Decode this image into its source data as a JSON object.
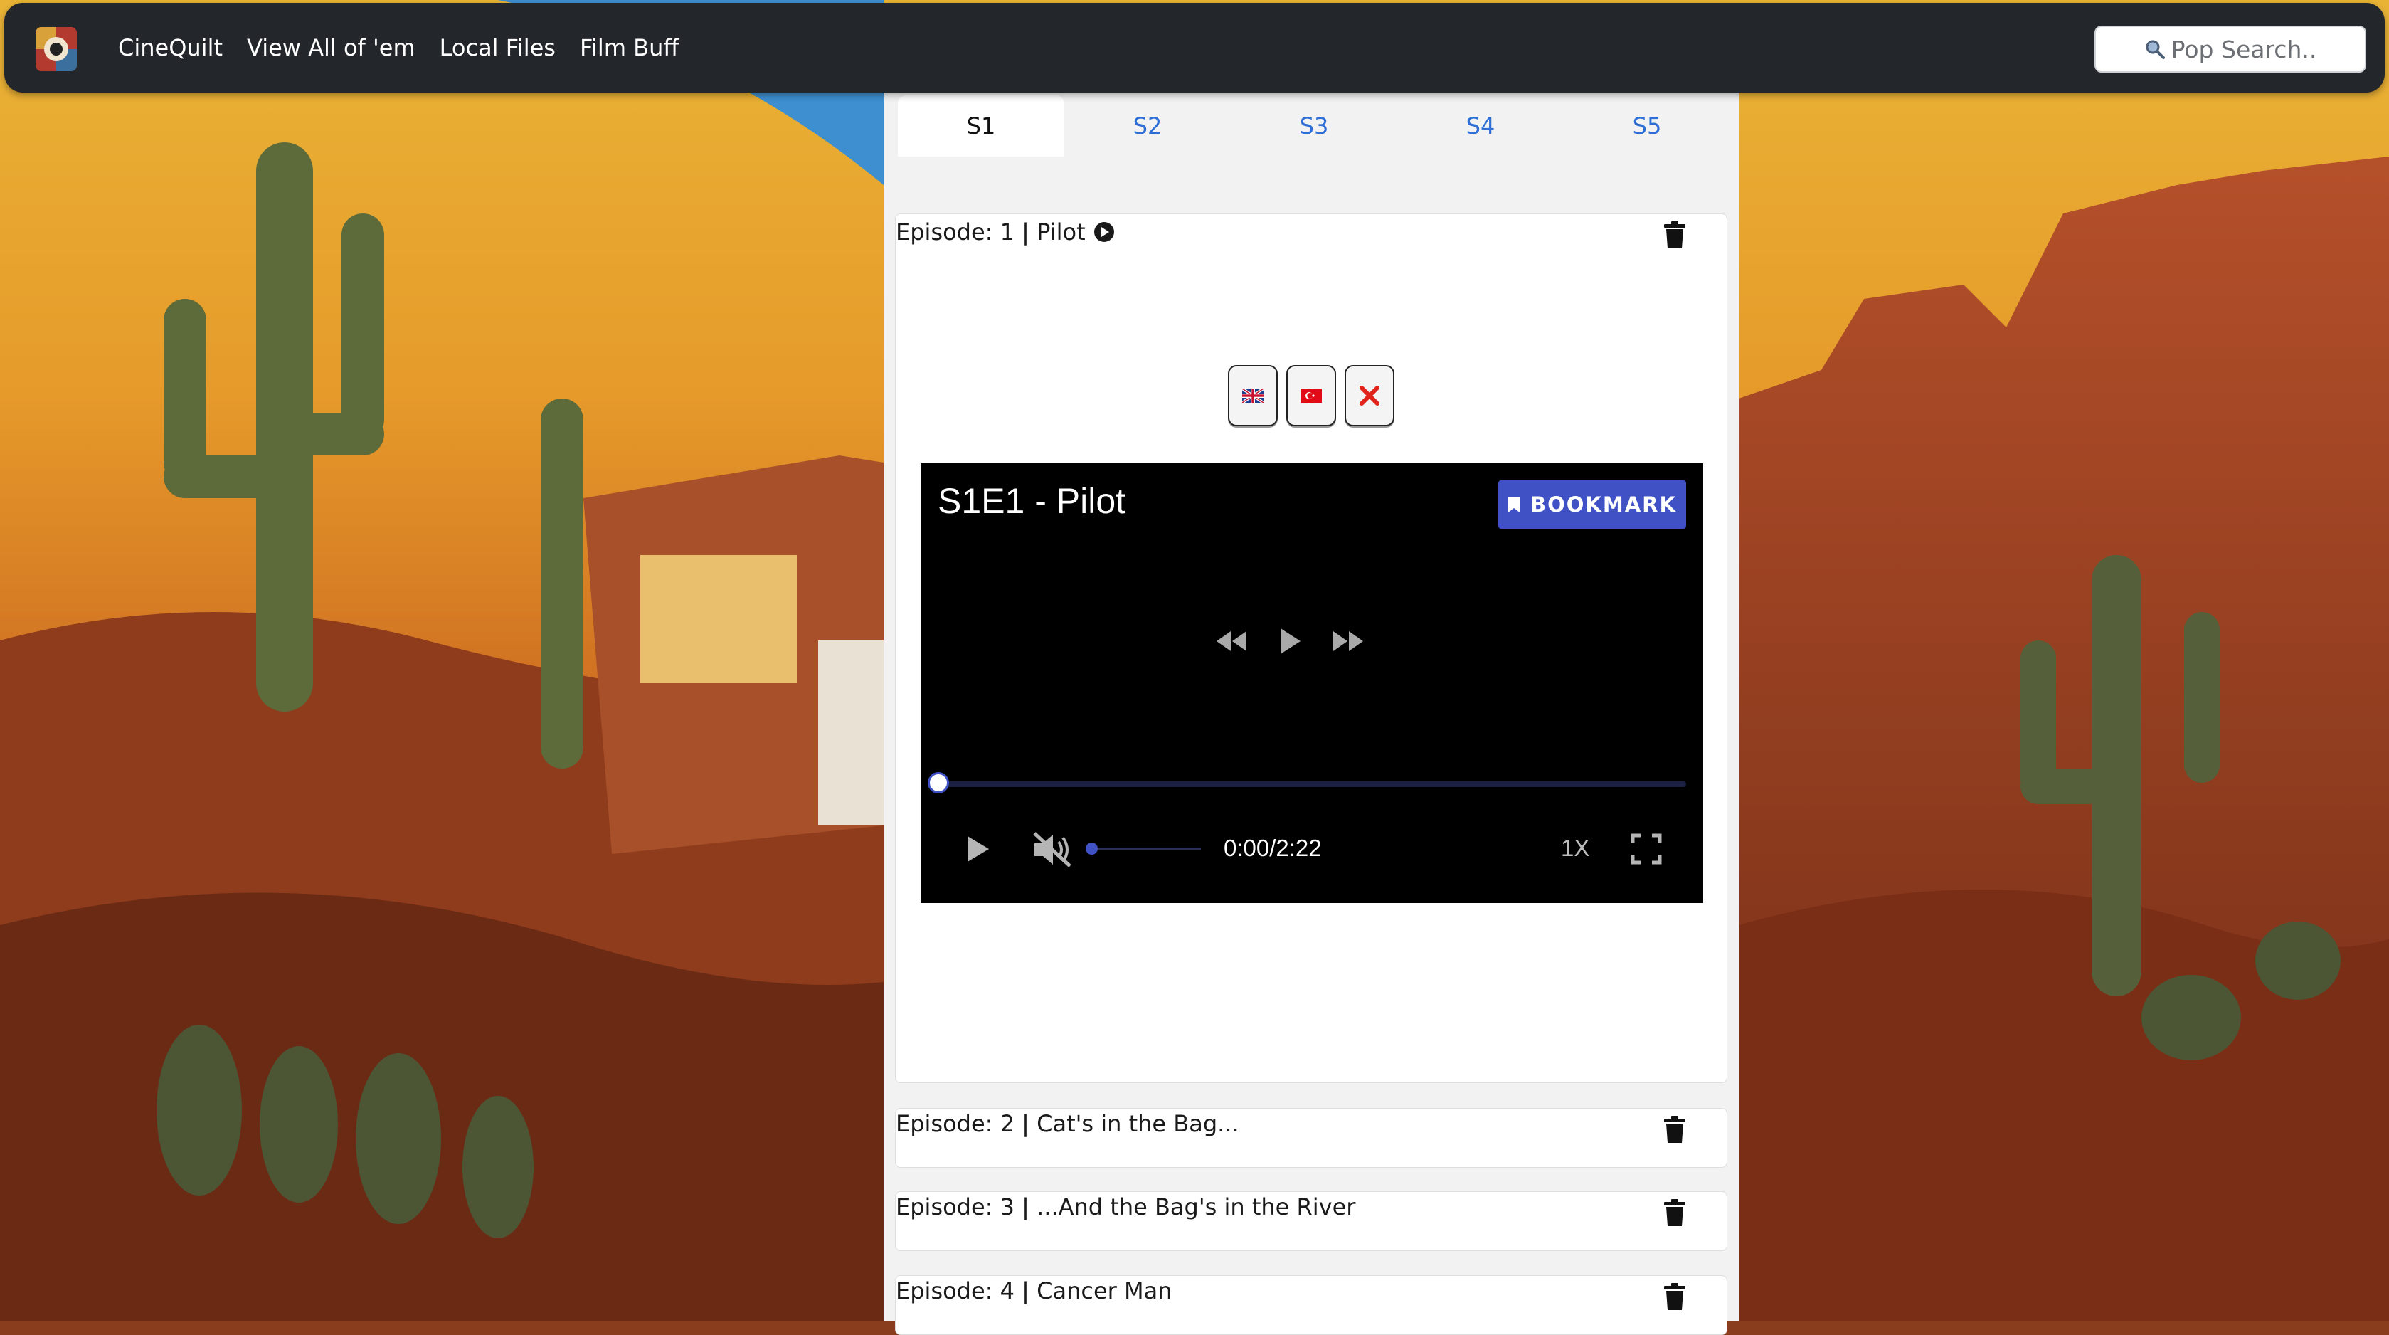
{
  "nav": {
    "links": [
      "CineQuilt",
      "View All of 'em",
      "Local Files",
      "Film Buff"
    ],
    "search_placeholder": "Pop Search.."
  },
  "tabs": [
    "S1",
    "S2",
    "S3",
    "S4",
    "S5"
  ],
  "active_tab": "S1",
  "episodes": [
    {
      "title": "Episode: 1 | Pilot"
    },
    {
      "title": "Episode: 2 | Cat's in the Bag..."
    },
    {
      "title": "Episode: 3 | ...And the Bag's in the River"
    },
    {
      "title": "Episode: 4 | Cancer Man"
    }
  ],
  "subtitle_buttons": [
    "uk-flag-icon",
    "turkey-flag-icon",
    "close-icon"
  ],
  "player": {
    "title": "S1E1 - Pilot",
    "bookmark_label": "BOOKMARK",
    "time": "0:00/2:22",
    "speed": "1X",
    "progress": 0,
    "muted": true,
    "volume": 0,
    "accent_color": "#3f51c5"
  },
  "colors": {
    "navbar": "#23272c",
    "tab_link": "#2d6fd6",
    "column_bg": "#f2f2f2"
  }
}
